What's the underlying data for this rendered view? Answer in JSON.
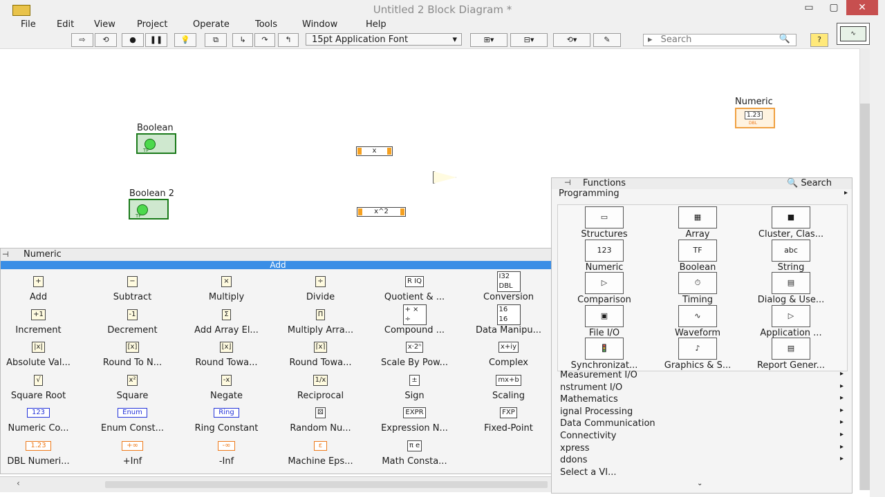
{
  "window": {
    "title": "Untitled 2 Block Diagram *",
    "minimize": "▭",
    "maximize": "▢",
    "close": "✕"
  },
  "menu": [
    "File",
    "Edit",
    "View",
    "Project",
    "Operate",
    "Tools",
    "Window",
    "Help"
  ],
  "toolbar": {
    "font": "15pt Application Font",
    "search_placeholder": "Search"
  },
  "diagram": {
    "boolean1_label": "Boolean",
    "boolean2_label": "Boolean 2",
    "boolean_tf": "TF",
    "multiply_label": "x",
    "square_label": "x^2",
    "numeric_label": "Numeric",
    "numeric_value": "1.23",
    "numeric_type": "DBL"
  },
  "numeric_palette": {
    "title": "Numeric",
    "selected": "Add",
    "items": [
      {
        "label": "Add",
        "icon": "add-icon",
        "glyph": "+"
      },
      {
        "label": "Subtract",
        "icon": "subtract-icon",
        "glyph": "−"
      },
      {
        "label": "Multiply",
        "icon": "multiply-icon",
        "glyph": "×"
      },
      {
        "label": "Divide",
        "icon": "divide-icon",
        "glyph": "÷"
      },
      {
        "label": "Quotient & ...",
        "icon": "quotient-icon",
        "glyph": "R IQ"
      },
      {
        "label": "Conversion",
        "icon": "conversion-icon",
        "glyph": "I32 DBL"
      },
      {
        "label": "Increment",
        "icon": "increment-icon",
        "glyph": "+1"
      },
      {
        "label": "Decrement",
        "icon": "decrement-icon",
        "glyph": "-1"
      },
      {
        "label": "Add Array El...",
        "icon": "add-array-icon",
        "glyph": "Σ"
      },
      {
        "label": "Multiply Arra...",
        "icon": "multiply-array-icon",
        "glyph": "Π"
      },
      {
        "label": "Compound ...",
        "icon": "compound-icon",
        "glyph": "+ × ÷"
      },
      {
        "label": "Data Manipu...",
        "icon": "data-manipulation-icon",
        "glyph": "16 16"
      },
      {
        "label": "Absolute Val...",
        "icon": "absolute-icon",
        "glyph": "|x|"
      },
      {
        "label": "Round To N...",
        "icon": "round-nearest-icon",
        "glyph": "[x]"
      },
      {
        "label": "Round Towa...",
        "icon": "round-toward-icon",
        "glyph": "⌊x⌋"
      },
      {
        "label": "Round Towa...",
        "icon": "round-toward-icon-2",
        "glyph": "⌈x⌉"
      },
      {
        "label": "Scale By Pow...",
        "icon": "scale-power-icon",
        "glyph": "x·2ⁿ"
      },
      {
        "label": "Complex",
        "icon": "complex-icon",
        "glyph": "x+iy"
      },
      {
        "label": "Square Root",
        "icon": "sqrt-icon",
        "glyph": "√"
      },
      {
        "label": "Square",
        "icon": "square-icon",
        "glyph": "x²"
      },
      {
        "label": "Negate",
        "icon": "negate-icon",
        "glyph": "-x"
      },
      {
        "label": "Reciprocal",
        "icon": "reciprocal-icon",
        "glyph": "1/x"
      },
      {
        "label": "Sign",
        "icon": "sign-icon",
        "glyph": "±"
      },
      {
        "label": "Scaling",
        "icon": "scaling-icon",
        "glyph": "mx+b"
      },
      {
        "label": "Numeric Co...",
        "icon": "numeric-const-icon",
        "glyph": "123"
      },
      {
        "label": "Enum Const...",
        "icon": "enum-const-icon",
        "glyph": "Enum"
      },
      {
        "label": "Ring Constant",
        "icon": "ring-const-icon",
        "glyph": "Ring"
      },
      {
        "label": "Random Nu...",
        "icon": "dice-icon",
        "glyph": "⚄"
      },
      {
        "label": "Expression N...",
        "icon": "expression-icon",
        "glyph": "EXPR"
      },
      {
        "label": "Fixed-Point",
        "icon": "fixed-point-icon",
        "glyph": "FXP"
      },
      {
        "label": "DBL Numeri...",
        "icon": "dbl-const-icon",
        "glyph": "1.23"
      },
      {
        "label": "+Inf",
        "icon": "pos-inf-icon",
        "glyph": "+∞"
      },
      {
        "label": "-Inf",
        "icon": "neg-inf-icon",
        "glyph": "-∞"
      },
      {
        "label": "Machine Eps...",
        "icon": "epsilon-icon",
        "glyph": "ε"
      },
      {
        "label": "Math Consta...",
        "icon": "pi-icon",
        "glyph": "π e"
      }
    ]
  },
  "functions_palette": {
    "title": "Functions",
    "search": "Search",
    "section": "Programming",
    "items": [
      {
        "label": "Structures",
        "icon": "structures-icon",
        "glyph": "▭"
      },
      {
        "label": "Array",
        "icon": "array-icon",
        "glyph": "▦"
      },
      {
        "label": "Cluster, Clas...",
        "icon": "cluster-icon",
        "glyph": "■"
      },
      {
        "label": "Numeric",
        "icon": "numeric-icon",
        "glyph": "123"
      },
      {
        "label": "Boolean",
        "icon": "boolean-icon",
        "glyph": "TF"
      },
      {
        "label": "String",
        "icon": "string-icon",
        "glyph": "abc"
      },
      {
        "label": "Comparison",
        "icon": "comparison-icon",
        "glyph": "▷"
      },
      {
        "label": "Timing",
        "icon": "timing-icon",
        "glyph": "⏱"
      },
      {
        "label": "Dialog & Use...",
        "icon": "dialog-icon",
        "glyph": "▤"
      },
      {
        "label": "File I/O",
        "icon": "file-io-icon",
        "glyph": "▣"
      },
      {
        "label": "Waveform",
        "icon": "waveform-icon",
        "glyph": "∿"
      },
      {
        "label": "Application ...",
        "icon": "application-icon",
        "glyph": "▷"
      },
      {
        "label": "Synchronizat...",
        "icon": "synchronization-icon",
        "glyph": "🚦"
      },
      {
        "label": "Graphics & S...",
        "icon": "graphics-icon",
        "glyph": "♪"
      },
      {
        "label": "Report Gener...",
        "icon": "report-icon",
        "glyph": "▤"
      }
    ],
    "categories": [
      "Measurement I/O",
      "nstrument I/O",
      "Mathematics",
      "ignal Processing",
      "Data Communication",
      "Connectivity",
      "xpress",
      "ddons",
      "Select a VI..."
    ]
  }
}
